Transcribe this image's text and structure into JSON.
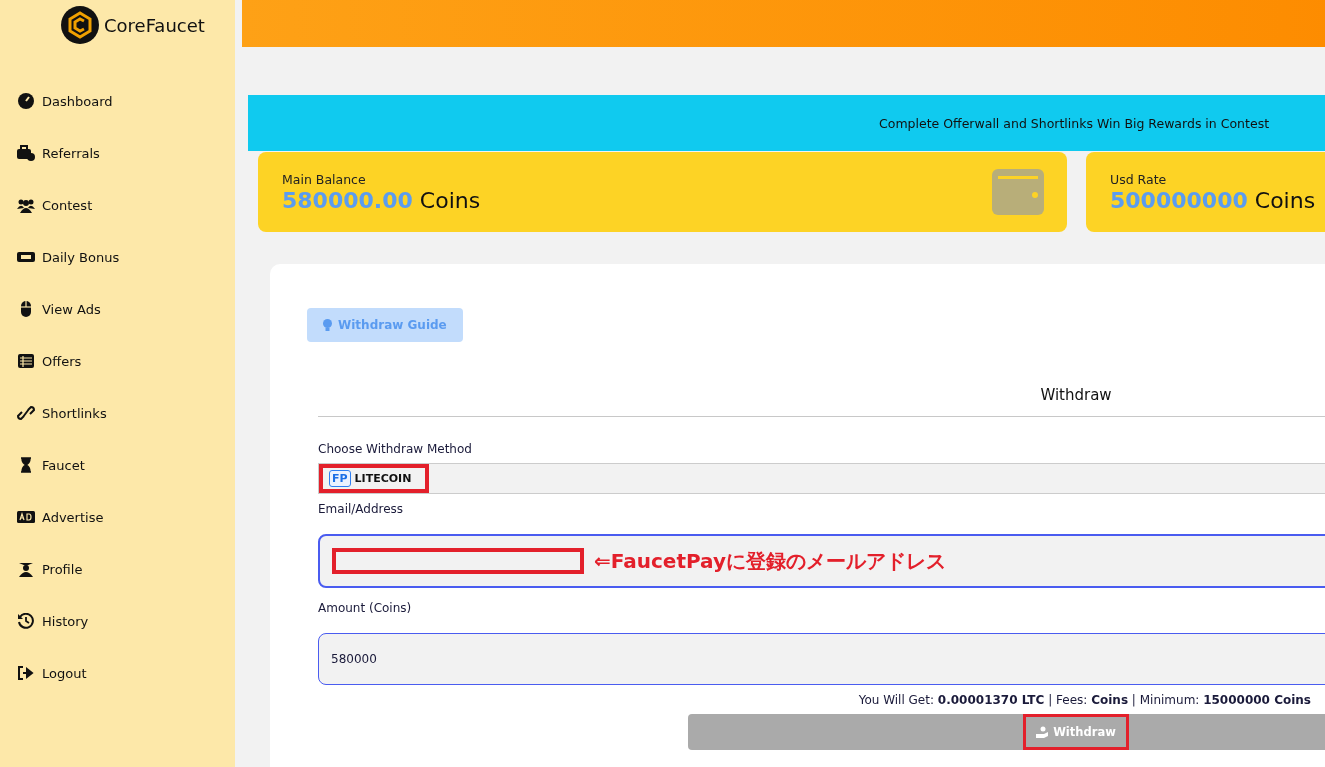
{
  "logo": {
    "text": "CoreFaucet"
  },
  "sidebar": {
    "items": [
      {
        "label": "Dashboard",
        "kind": "gauge"
      },
      {
        "label": "Referrals",
        "kind": "briefcase"
      },
      {
        "label": "Contest",
        "kind": "users"
      },
      {
        "label": "Daily Bonus",
        "kind": "ticket"
      },
      {
        "label": "View Ads",
        "kind": "mouse"
      },
      {
        "label": "Offers",
        "kind": "table"
      },
      {
        "label": "Shortlinks",
        "kind": "link"
      },
      {
        "label": "Faucet",
        "kind": "hourglass"
      },
      {
        "label": "Advertise",
        "kind": "ad"
      },
      {
        "label": "Profile",
        "kind": "graduate"
      },
      {
        "label": "History",
        "kind": "history"
      },
      {
        "label": "Logout",
        "kind": "logout"
      }
    ]
  },
  "banner": {
    "text": "Complete Offerwall and Shortlinks Win Big Rewards in Contest"
  },
  "cards": [
    {
      "label": "Main Balance",
      "amount": "580000.00",
      "unit": "Coins"
    },
    {
      "label": "Usd Rate",
      "amount": "500000000",
      "unit": "Coins"
    }
  ],
  "guide_button": {
    "label": "Withdraw Guide"
  },
  "form": {
    "title": "Withdraw",
    "method_label": "Choose Withdraw Method",
    "method": {
      "badge": "FP",
      "label": "LITECOIN",
      "highlighted": true
    },
    "address_label": "Email/Address",
    "address_redacted": true,
    "address_note": "⇐FaucetPayに登録のメールアドレス",
    "amount_label": "Amount (Coins)",
    "amount_value": "580000",
    "summary": "You Will Get: **0.00001370 LTC** | Fees: **Coins** | Minimum: **15000000 Coins**",
    "submit": {
      "label": "Withdraw",
      "highlighted": true
    }
  }
}
